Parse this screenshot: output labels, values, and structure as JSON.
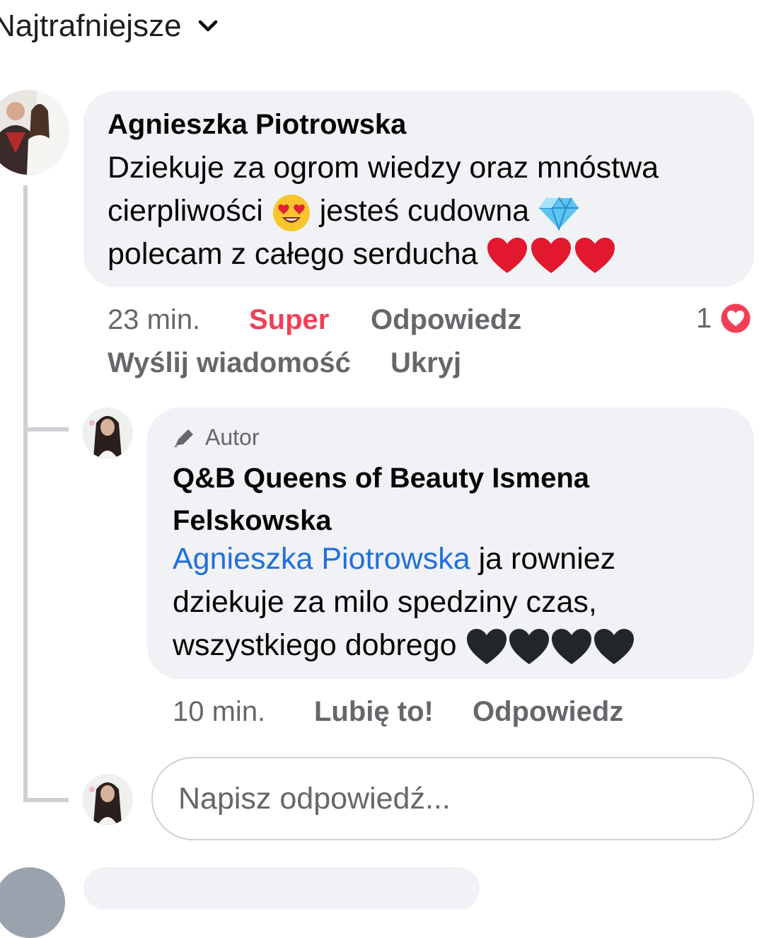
{
  "sort": {
    "label": "Najtrafniejsze"
  },
  "comment": {
    "author": "Agnieszka Piotrowska",
    "line1": "Dziekuje za ogrom wiedzy oraz mnóstwa",
    "line2a": "cierpliwości",
    "line2b": "jesteś cudowna",
    "line3": "polecam z całego serducha",
    "time": "23 min.",
    "reaction_label": "Super",
    "reply_label": "Odpowiedz",
    "message_label": "Wyślij wiadomość",
    "hide_label": "Ukryj",
    "reaction_count": "1",
    "reaction_color": "#f33e58"
  },
  "reply": {
    "badge": "Autor",
    "author_line1": "Q&B Queens of Beauty Ismena",
    "author_line2": "Felskowska",
    "mention": "Agnieszka Piotrowska",
    "text1": "ja rowniez",
    "text2": "dziekuje za milo spedziny czas,",
    "text3": "wszystkiego dobrego",
    "time": "10 min.",
    "like_label": "Lubię to!",
    "reply_label": "Odpowiedz"
  },
  "composer": {
    "placeholder": "Napisz odpowiedź..."
  },
  "colors": {
    "mention": "#216fdb",
    "super": "#f33e58",
    "bubble": "#f0f2f5"
  }
}
